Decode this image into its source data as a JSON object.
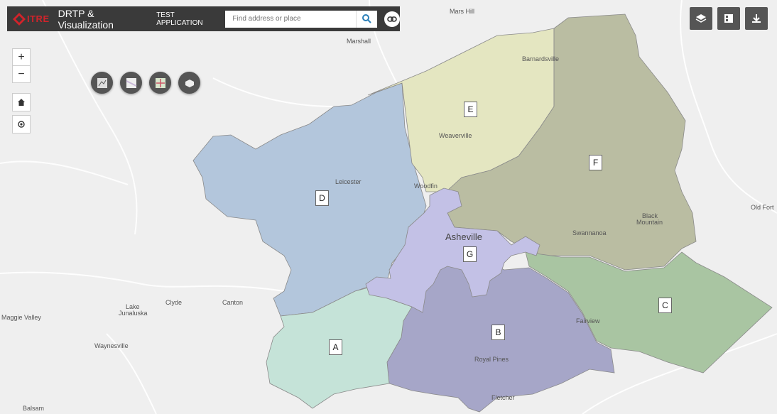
{
  "header": {
    "logo_text": "ITRE",
    "title": "DRTP & Visualization",
    "subtitle": "TEST APPLICATION",
    "search_placeholder": "Find address or place"
  },
  "zoom": {
    "in_label": "+",
    "out_label": "−"
  },
  "zones": [
    {
      "label": "A",
      "color": "#c5e3d8"
    },
    {
      "label": "B",
      "color": "#a6a6c8"
    },
    {
      "label": "C",
      "color": "#a9c5a2"
    },
    {
      "label": "D",
      "color": "#b3c6dc"
    },
    {
      "label": "E",
      "color": "#e4e6c1"
    },
    {
      "label": "F",
      "color": "#babdA2"
    },
    {
      "label": "G",
      "color": "#c3c1e6"
    }
  ],
  "places": {
    "mars_hill": "Mars Hill",
    "marshall": "Marshall",
    "barnardsville": "Barnardsville",
    "weaverville": "Weaverville",
    "leicester": "Leicester",
    "woodfin": "Woodfin",
    "asheville": "Asheville",
    "black": "Black",
    "mountain": "Mountain",
    "swannanoa": "Swannanoa",
    "old_fort": "Old Fort",
    "fairview": "Fairview",
    "royal_pines": "Royal Pines",
    "fletcher": "Fletcher",
    "clyde": "Clyde",
    "canton": "Canton",
    "lake": "Lake",
    "junaluska": "Junaluska",
    "maggie_valley": "Maggie Valley",
    "waynesville": "Waynesville",
    "balsam": "Balsam"
  }
}
